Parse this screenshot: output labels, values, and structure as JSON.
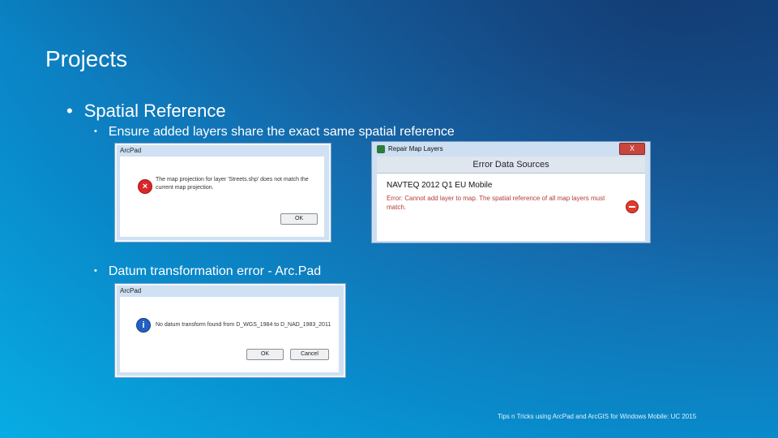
{
  "slide": {
    "title": "Projects",
    "bullet_main": "Spatial Reference",
    "bullet_sub1": "Ensure added layers share the exact same spatial reference",
    "bullet_sub2": "Datum transformation error - Arc.Pad",
    "footer": "Tips n Tricks using ArcPad and ArcGIS for Windows Mobile: UC 2015",
    "bullet_glyph": "•"
  },
  "dialog_arcpad_error": {
    "caption": "ArcPad",
    "message": "The map projection for layer 'Streets.shp' does not match the current map projection.",
    "ok_label": "OK",
    "icon": "error-icon"
  },
  "dialog_repair": {
    "caption": "Repair Map Layers",
    "close_label": "X",
    "header": "Error Data Sources",
    "layer_name": "NAVTEQ 2012 Q1 EU Mobile",
    "error_text": "Error: Cannot add layer to map. The spatial reference of all map layers must match.",
    "icon": "stop-icon"
  },
  "dialog_arcpad_datum": {
    "caption": "ArcPad",
    "message": "No datum transform found from D_WGS_1984 to D_NAD_1983_2011",
    "ok_label": "OK",
    "cancel_label": "Cancel",
    "icon": "info-icon"
  },
  "colors": {
    "background_top": "#1a4a86",
    "background_bottom": "#0aa6e0",
    "error_text": "#b53b3b"
  }
}
